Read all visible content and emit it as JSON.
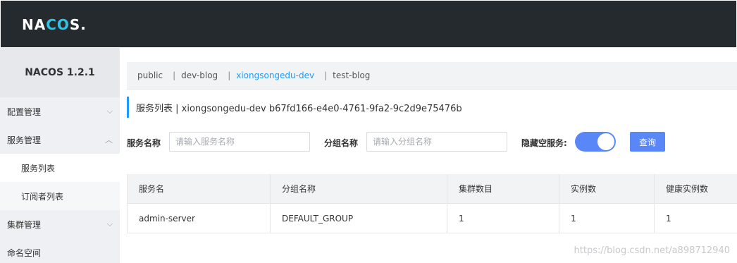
{
  "app": {
    "logo_prefix": "NA",
    "logo_accent": "CO",
    "logo_suffix": "S."
  },
  "sidebar": {
    "version": "NACOS 1.2.1",
    "items": [
      {
        "label": "配置管理",
        "arrow": "⌵"
      },
      {
        "label": "服务管理",
        "arrow": "︿"
      },
      {
        "label": "服务列表"
      },
      {
        "label": "订阅者列表"
      },
      {
        "label": "集群管理",
        "arrow": "⌵"
      },
      {
        "label": "命名空间"
      }
    ]
  },
  "namespaces": {
    "items": [
      "public",
      "dev-blog",
      "xiongsongedu-dev",
      "test-blog"
    ],
    "separator": "|",
    "active": "xiongsongedu-dev"
  },
  "page": {
    "title": "服务列表  |  xiongsongedu-dev  b67fd166-e4e0-4761-9fa2-9c2d9e75476b"
  },
  "filters": {
    "service_label": "服务名称",
    "service_placeholder": "请输入服务名称",
    "group_label": "分组名称",
    "group_placeholder": "请输入分组名称",
    "hide_empty_label": "隐藏空服务:",
    "query_label": "查询"
  },
  "table": {
    "headers": [
      "服务名",
      "分组名称",
      "集群数目",
      "实例数",
      "健康实例数"
    ],
    "rows": [
      [
        "admin-server",
        "DEFAULT_GROUP",
        "1",
        "1",
        "1"
      ]
    ]
  },
  "watermark": "https://blog.csdn.net/a898712940",
  "colors": {
    "topbar": "#252a2f",
    "accent": "#209bfa",
    "button": "#5a87f7"
  }
}
